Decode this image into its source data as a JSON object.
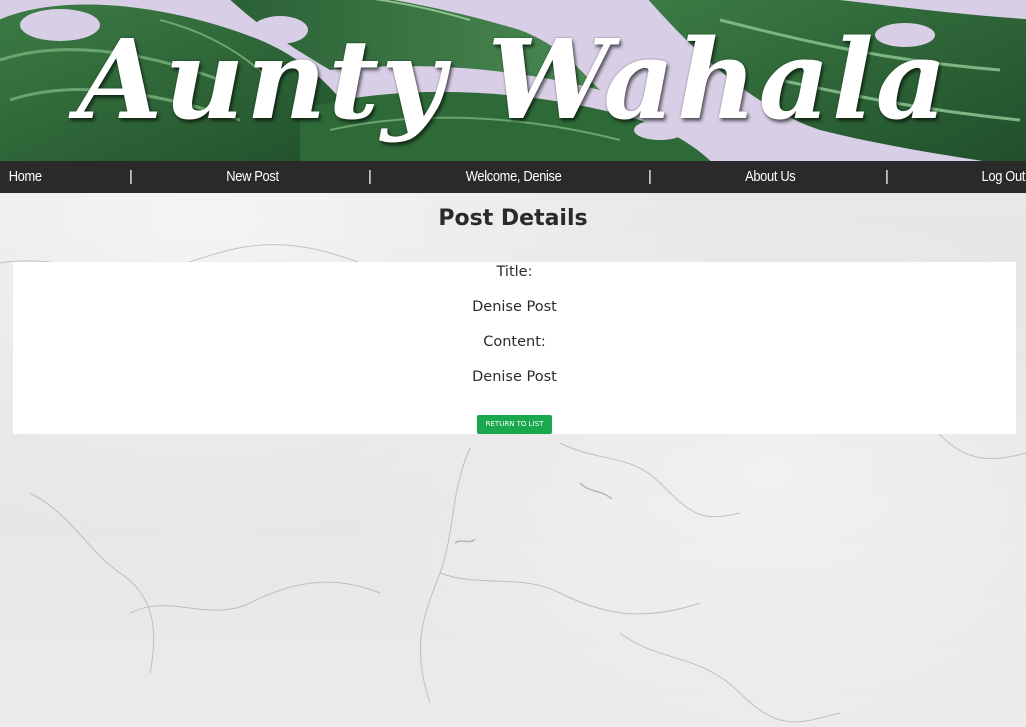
{
  "banner": {
    "title": "Aunty Wahala"
  },
  "nav": {
    "home": "Home",
    "new_post": "New Post",
    "welcome": "Welcome, Denise",
    "about": "About Us",
    "logout": "Log Out",
    "separator": "|"
  },
  "page": {
    "heading": "Post Details"
  },
  "post": {
    "title_label": "Title:",
    "title_value": "Denise Post",
    "content_label": "Content:",
    "content_value": "Denise Post",
    "return_button": "RETURN TO LIST"
  },
  "colors": {
    "nav_bg": "#2a2a2a",
    "button_green": "#1aa84f",
    "banner_lavender": "#d8cfe6",
    "leaf_green": "#2f6b3a"
  },
  "icons": {
    "banner_art": "monstera-leaves"
  }
}
